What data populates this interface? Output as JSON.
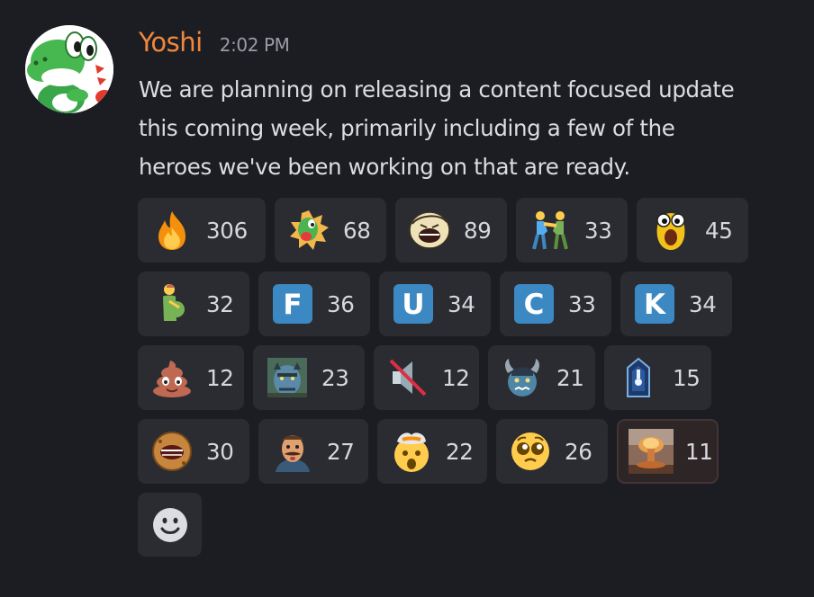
{
  "message": {
    "author": "Yoshi",
    "author_color": "#f0883e",
    "timestamp": "2:02 PM",
    "lines": [
      "We are planning on releasing a content focused update",
      "this coming week, primarily including a few of the",
      "heroes we've been working on that are ready."
    ]
  },
  "reactions": [
    {
      "emoji": "fire-icon",
      "count": "306"
    },
    {
      "emoji": "yoshi-sticker-icon",
      "count": "68"
    },
    {
      "emoji": "screaming-face-icon",
      "count": "89"
    },
    {
      "emoji": "wrestlers-icon",
      "count": "33"
    },
    {
      "emoji": "shocked-bug-icon",
      "count": "45"
    },
    {
      "emoji": "pregnant-man-icon",
      "count": "32"
    },
    {
      "emoji": "regional-indicator-f-icon",
      "count": "36",
      "letter": "F"
    },
    {
      "emoji": "regional-indicator-u-icon",
      "count": "34",
      "letter": "U"
    },
    {
      "emoji": "regional-indicator-c-icon",
      "count": "33",
      "letter": "C"
    },
    {
      "emoji": "regional-indicator-k-icon",
      "count": "34",
      "letter": "K"
    },
    {
      "emoji": "poop-icon",
      "count": "12"
    },
    {
      "emoji": "blue-orc-portrait-icon",
      "count": "23"
    },
    {
      "emoji": "muted-speaker-icon",
      "count": "12"
    },
    {
      "emoji": "horned-orc-icon",
      "count": "21"
    },
    {
      "emoji": "blue-tower-icon",
      "count": "15"
    },
    {
      "emoji": "screaming-cookie-icon",
      "count": "30"
    },
    {
      "emoji": "mustache-man-icon",
      "count": "27"
    },
    {
      "emoji": "exploding-head-icon",
      "count": "22"
    },
    {
      "emoji": "pleading-face-icon",
      "count": "26"
    },
    {
      "emoji": "nuclear-explosion-icon",
      "count": "11",
      "selected": true
    }
  ],
  "add_reaction_icon": "smiley-add-icon"
}
